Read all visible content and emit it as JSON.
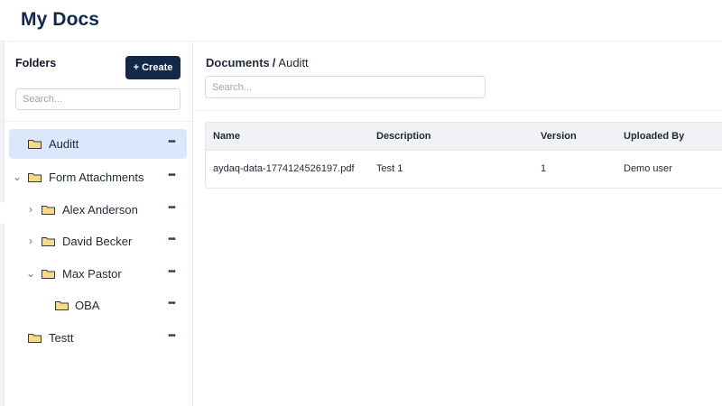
{
  "header": {
    "title": "My Docs"
  },
  "sidebar": {
    "title": "Folders",
    "create_label": "+ Create",
    "search_placeholder": "Search...",
    "tree": [
      {
        "label": "Auditt",
        "selected": true,
        "expanded": null
      },
      {
        "label": "Form Attachments",
        "selected": false,
        "expanded": true
      },
      {
        "label": "Alex Anderson",
        "selected": false,
        "expanded": false
      },
      {
        "label": "David Becker",
        "selected": false,
        "expanded": false
      },
      {
        "label": "Max Pastor",
        "selected": false,
        "expanded": true
      },
      {
        "label": "OBA",
        "selected": false,
        "expanded": null
      },
      {
        "label": "Testt",
        "selected": false,
        "expanded": null
      }
    ],
    "more_icon": "more-horizontal-icon",
    "folder_icon": "folder-icon",
    "folder_color": "#f6d98a"
  },
  "main": {
    "breadcrumb": {
      "root": "Documents",
      "separator": "/",
      "current": "Auditt"
    },
    "search_placeholder": "Search...",
    "table": {
      "columns": [
        "Name",
        "Description",
        "Version",
        "Uploaded By"
      ],
      "rows": [
        {
          "name": "aydaq-data-1774124526197.pdf",
          "description": "Test 1",
          "version": "1",
          "uploaded_by": "Demo user"
        }
      ]
    }
  },
  "colors": {
    "brand_navy": "#12284b",
    "selected_row": "#dbe8fb",
    "table_header_bg": "#f1f2f5"
  }
}
